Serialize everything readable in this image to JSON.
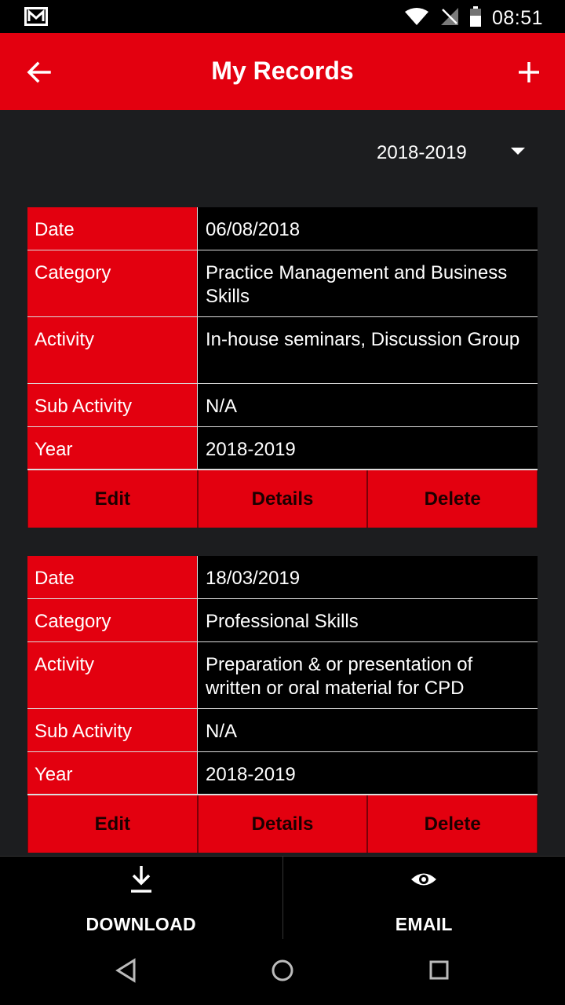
{
  "status_bar": {
    "time": "08:51",
    "icons": [
      "mail-notification-icon",
      "wifi-icon",
      "no-signal-icon",
      "battery-icon"
    ]
  },
  "app_bar": {
    "title": "My Records",
    "back_icon": "arrow-left-icon",
    "add_icon": "plus-icon"
  },
  "year_filter": {
    "selected": "2018-2019"
  },
  "records": [
    {
      "fields": [
        {
          "label": "Date",
          "value": "06/08/2018"
        },
        {
          "label": "Category",
          "value": "Practice Management and Business Skills"
        },
        {
          "label": "Activity",
          "value": "In-house seminars, Discussion Group"
        },
        {
          "label": "Sub Activity",
          "value": "N/A"
        },
        {
          "label": "Year",
          "value": "2018-2019"
        }
      ],
      "actions": {
        "edit": "Edit",
        "details": "Details",
        "delete": "Delete"
      }
    },
    {
      "fields": [
        {
          "label": "Date",
          "value": "18/03/2019"
        },
        {
          "label": "Category",
          "value": "Professional Skills"
        },
        {
          "label": "Activity",
          "value": "Preparation & or presentation of written or oral material for CPD"
        },
        {
          "label": "Sub Activity",
          "value": "N/A"
        },
        {
          "label": "Year",
          "value": "2018-2019"
        }
      ],
      "actions": {
        "edit": "Edit",
        "details": "Details",
        "delete": "Delete"
      }
    }
  ],
  "bottom_actions": {
    "download": "DOWNLOAD",
    "email": "EMAIL"
  },
  "colors": {
    "accent": "#e3000f",
    "background": "#1c1d1f",
    "cell_background": "#000000"
  }
}
